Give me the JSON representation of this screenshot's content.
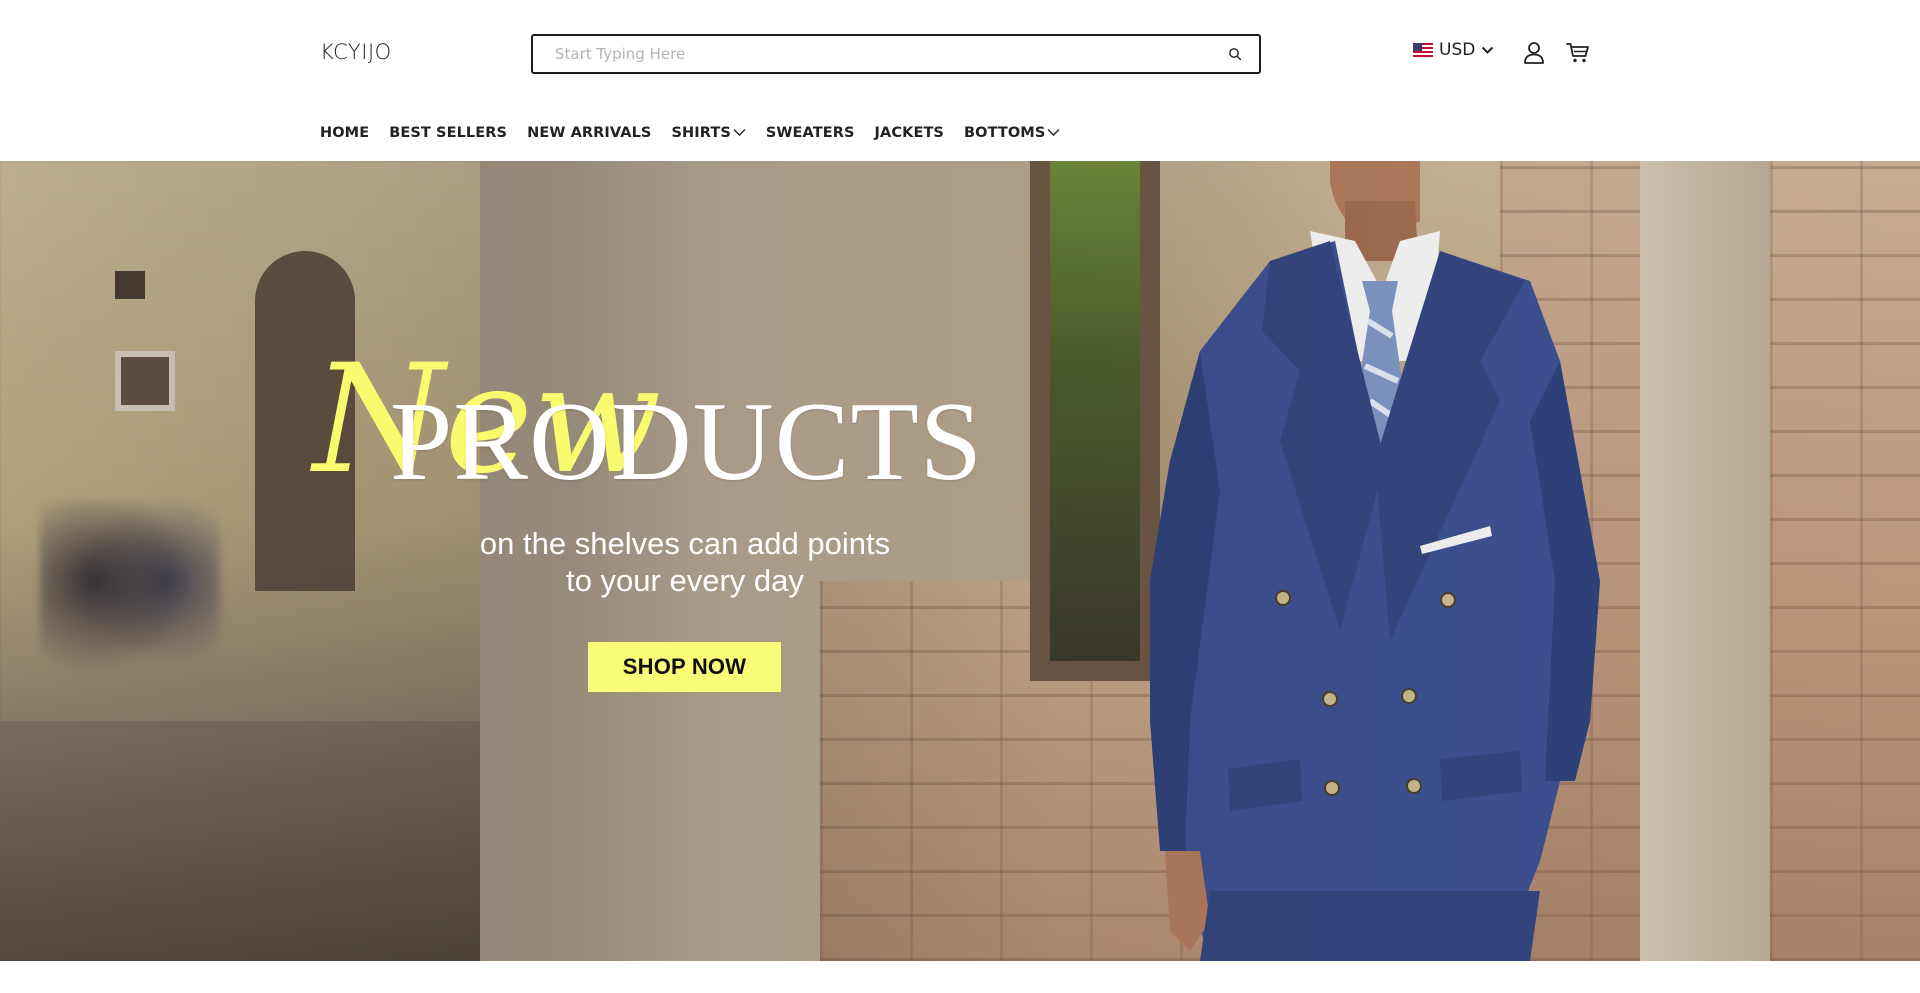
{
  "header": {
    "logo": "KCYIJO",
    "search": {
      "placeholder": "Start Typing Here",
      "value": ""
    },
    "currency": {
      "code": "USD",
      "flag": "us-flag-icon"
    },
    "icons": [
      "search-icon",
      "chevron-down-icon",
      "user-icon",
      "cart-icon"
    ]
  },
  "nav": {
    "items": [
      {
        "label": "HOME",
        "has_dropdown": false
      },
      {
        "label": "BEST SELLERS",
        "has_dropdown": false
      },
      {
        "label": "NEW ARRIVALS",
        "has_dropdown": false
      },
      {
        "label": "SHIRTS",
        "has_dropdown": true
      },
      {
        "label": "SWEATERS",
        "has_dropdown": false
      },
      {
        "label": "JACKETS",
        "has_dropdown": false
      },
      {
        "label": "BOTTOMS",
        "has_dropdown": true
      }
    ]
  },
  "hero": {
    "script_word": "New",
    "title": "PRODUCTS",
    "subtitle_line1": "on the shelves can add points",
    "subtitle_line2": "to your every day",
    "cta_label": "SHOP NOW"
  },
  "colors": {
    "accent_yellow": "#fbfb7a",
    "script_yellow": "#fafa6e",
    "suit_blue": "#3b4f8c",
    "text_dark": "#1a1a1a"
  }
}
